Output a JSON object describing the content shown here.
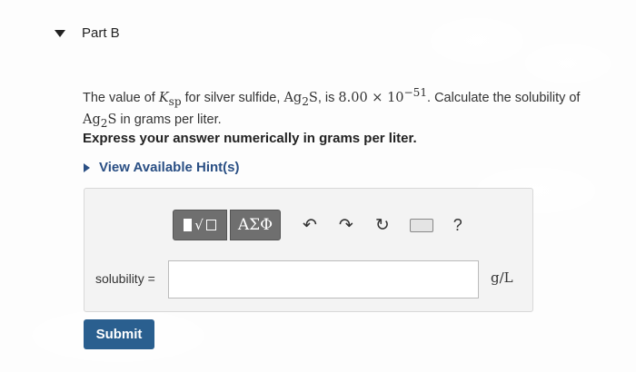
{
  "part": {
    "title": "Part B"
  },
  "question": {
    "prefix": "The value of ",
    "k": "K",
    "k_sub": "sp",
    "mid1": " for silver sulfide, ",
    "ag": "Ag",
    "ag_sub": "2",
    "s": "S",
    "mid2": ", is ",
    "mantissa": "8.00",
    "times": " × ",
    "base": "10",
    "exponent": "−51",
    "mid3": ". Calculate the solubility of ",
    "ag2": "Ag",
    "ag2_sub": "2",
    "s2": "S",
    "suffix": " in grams per liter."
  },
  "instruction": "Express your answer numerically in grams per liter.",
  "hints": {
    "label": "View Available Hint(s)"
  },
  "toolbar": {
    "templates_icon": "templates-icon",
    "radical": "√",
    "greek_label": "ΑΣΦ",
    "undo_icon": "↶",
    "redo_icon": "↷",
    "reset_icon": "↻",
    "keyboard_icon": "keyboard-icon",
    "help_label": "?"
  },
  "answer": {
    "label": "solubility =",
    "value": "",
    "unit": "g/L"
  },
  "submit": {
    "label": "Submit"
  },
  "colors": {
    "accent": "#2a5f8f",
    "link": "#2a4f84",
    "toolbar": "#6f6f6f"
  }
}
